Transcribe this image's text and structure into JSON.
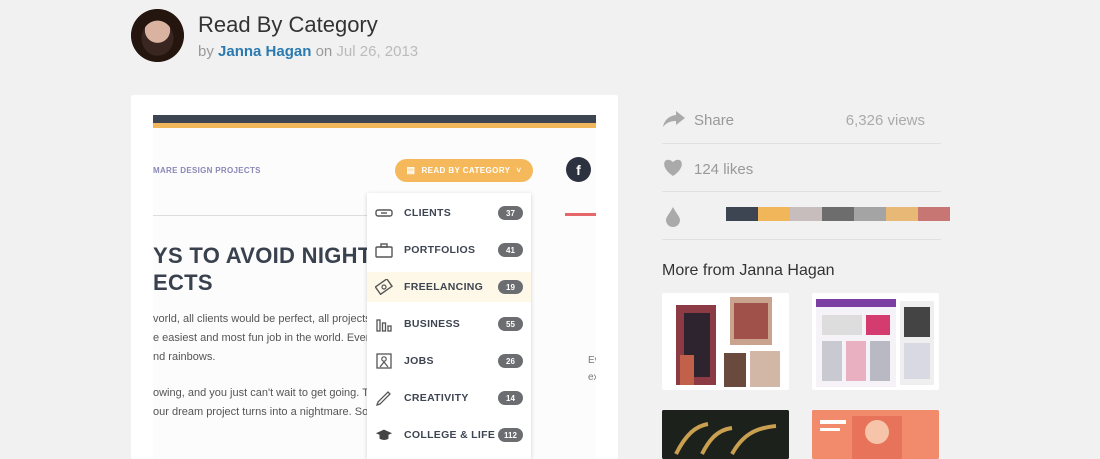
{
  "header": {
    "title": "Read By Category",
    "by": "by",
    "author": "Janna Hagan",
    "on": "on",
    "date": "Jul 26, 2013"
  },
  "shot": {
    "project_link": "MARE DESIGN PROJECTS",
    "category_button": "READ BY CATEGORY",
    "facebook": "f",
    "headline_line1": "YS TO AVOID NIGHTI",
    "headline_line2": "ECTS",
    "body": [
      "vorld, all clients would be perfect, all projects",
      "e easiest and most fun job in the world. Ever",
      "nd rainbows.",
      "",
      "owing, and you just can't wait to get going. Th",
      "our dream project turns into a nightmare. So"
    ],
    "side_fragment": [
      "Ev",
      "ex"
    ],
    "categories": [
      {
        "label": "CLIENTS",
        "count": "37",
        "icon": "handshake-icon"
      },
      {
        "label": "PORTFOLIOS",
        "count": "41",
        "icon": "briefcase-icon"
      },
      {
        "label": "FREELANCING",
        "count": "19",
        "icon": "money-icon"
      },
      {
        "label": "BUSINESS",
        "count": "55",
        "icon": "bar-chart-icon"
      },
      {
        "label": "JOBS",
        "count": "26",
        "icon": "person-icon"
      },
      {
        "label": "CREATIVITY",
        "count": "14",
        "icon": "pen-icon"
      },
      {
        "label": "COLLEGE & LIFE",
        "count": "112",
        "icon": "graduation-cap-icon"
      }
    ]
  },
  "sidebar": {
    "share_label": "Share",
    "views": "6,326 views",
    "likes": "124 likes",
    "palette": [
      "#3e4552",
      "#f2b65a",
      "#c8bdbd",
      "#6d6d6d",
      "#a4a4a4",
      "#e8b876",
      "#c87674"
    ],
    "more_title": "More from Janna Hagan"
  }
}
